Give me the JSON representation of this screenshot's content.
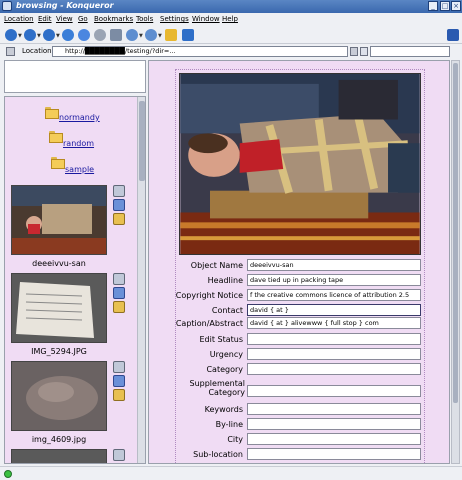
{
  "window": {
    "title": "browsing - Konqueror"
  },
  "menu": [
    "Location",
    "Edit",
    "View",
    "Go",
    "Bookmarks",
    "Tools",
    "Settings",
    "Window",
    "Help"
  ],
  "location": {
    "label": "Location:",
    "url": "http://████████/testing/?dir=..."
  },
  "sidebar": {
    "folders": [
      "normandy",
      "random",
      "sample"
    ],
    "thumbnails": [
      "deeeivvu-san",
      "IMG_5294.JPG",
      "img_4609.jpg"
    ]
  },
  "fields": [
    {
      "label": "Object Name",
      "value": "deeeivvu-san"
    },
    {
      "label": "Headline",
      "value": "dave tied up in packing tape"
    },
    {
      "label": "Copyright Notice",
      "value": "f the creative commons licence of attribution 2.5"
    },
    {
      "label": "Contact",
      "value": "david { at }"
    },
    {
      "label": "Caption/Abstract",
      "value": "david { at } alivewww { full stop } com"
    },
    {
      "label": "Edit Status",
      "value": ""
    },
    {
      "label": "Urgency",
      "value": ""
    },
    {
      "label": "Category",
      "value": ""
    },
    {
      "label": "Supplemental Category",
      "value": ""
    },
    {
      "label": "Keywords",
      "value": ""
    },
    {
      "label": "By-line",
      "value": ""
    },
    {
      "label": "City",
      "value": ""
    },
    {
      "label": "Sub-location",
      "value": ""
    }
  ],
  "colors": {
    "panel": "#f0dcf4",
    "titlebar": "#3a68ae",
    "link": "#1a1aa0"
  }
}
